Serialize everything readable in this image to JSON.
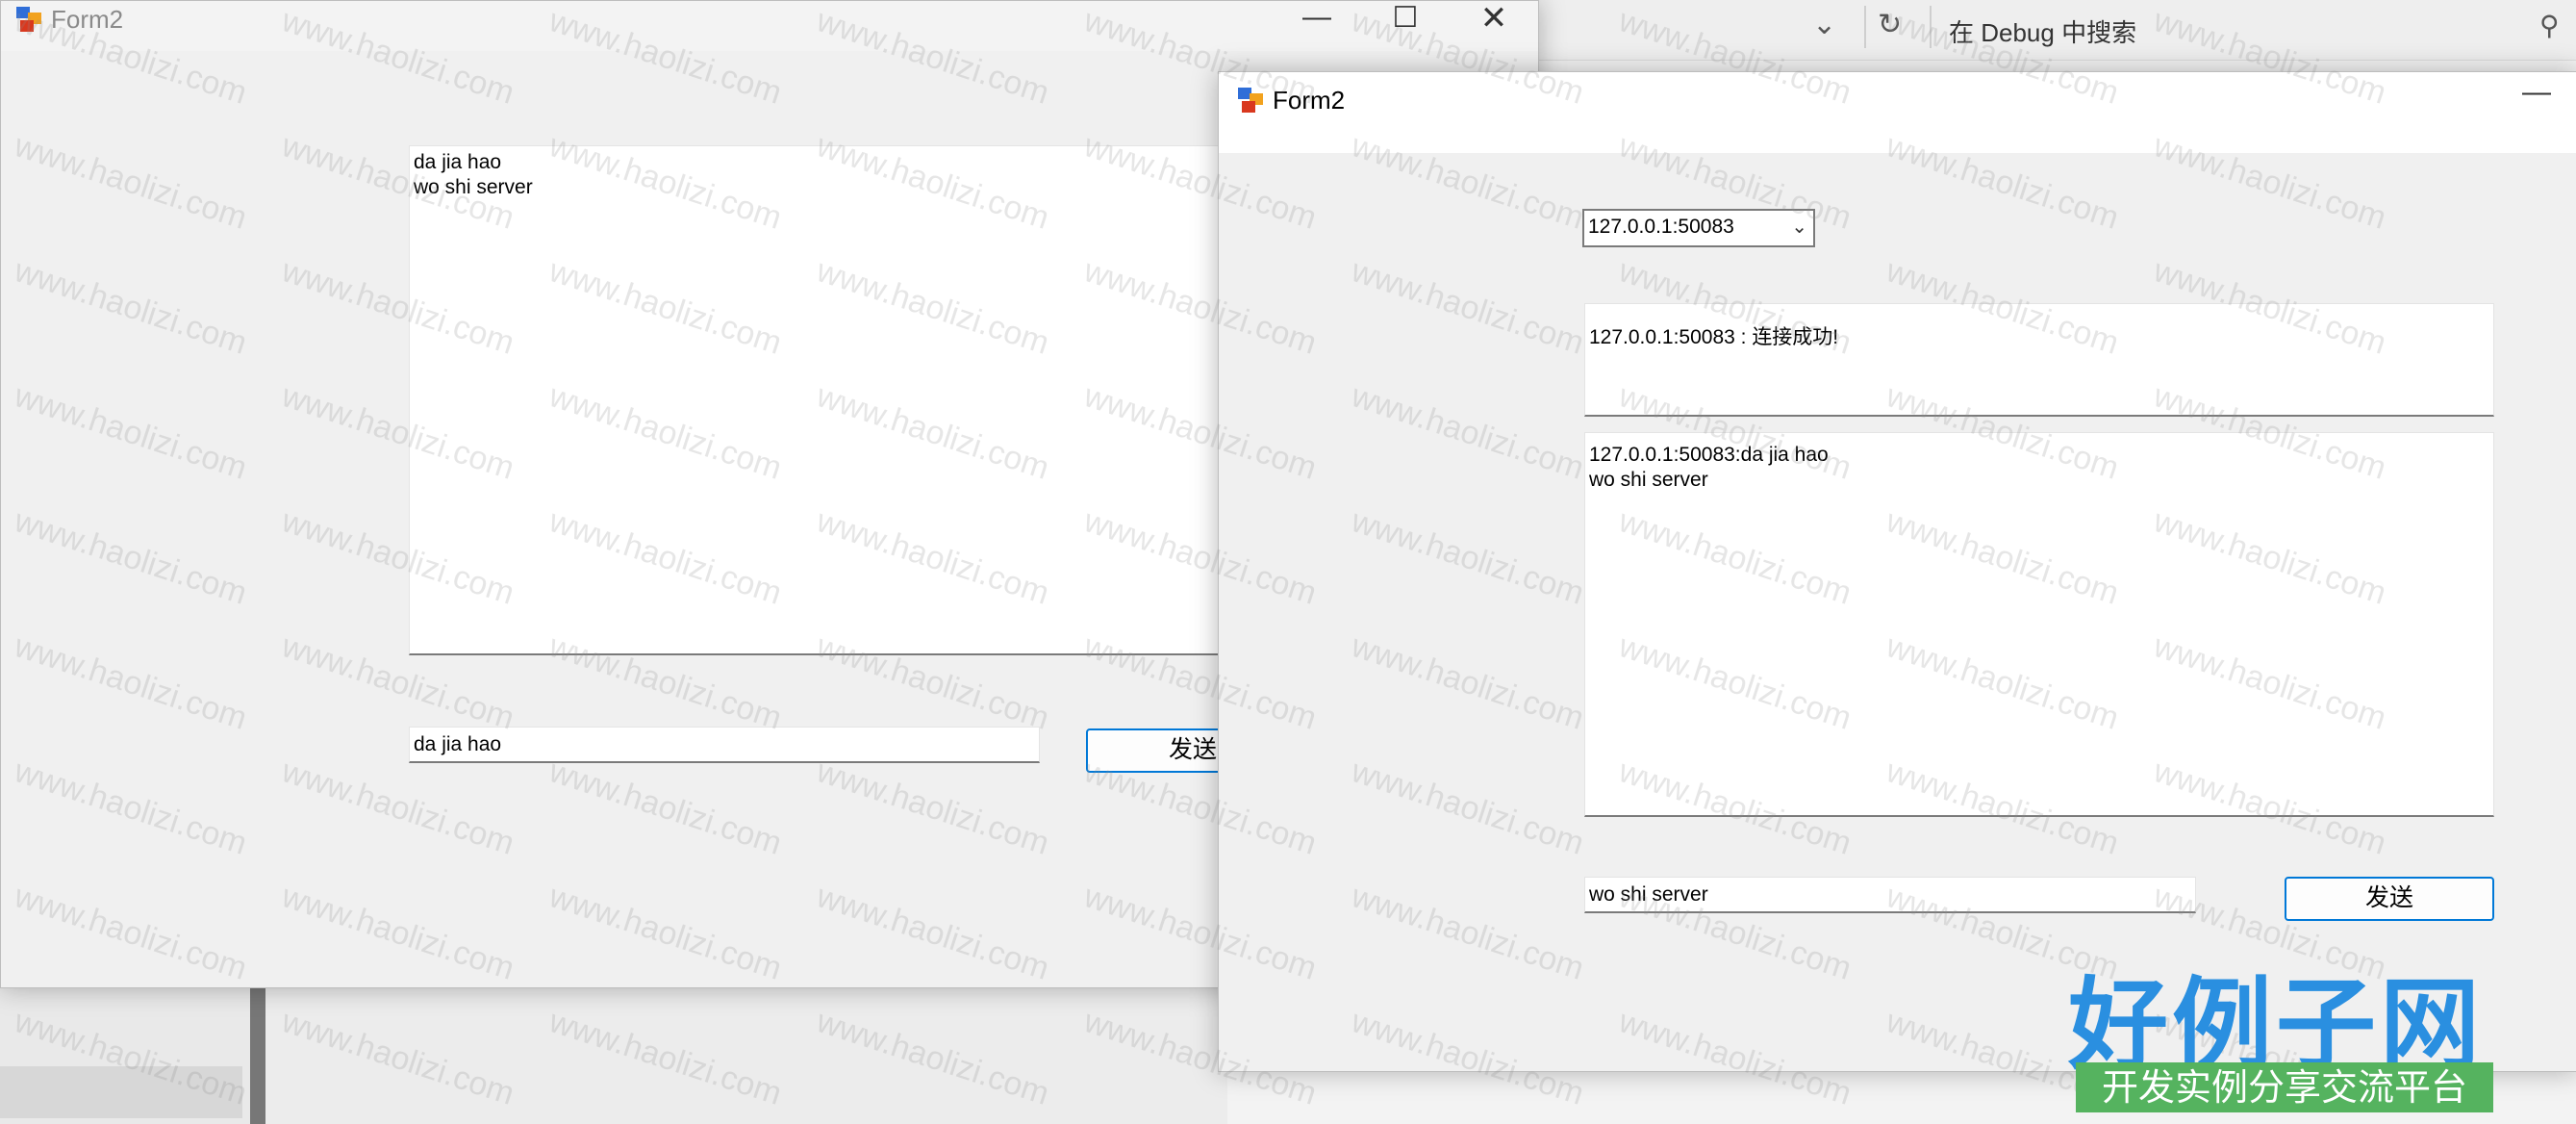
{
  "ide": {
    "search_placeholder": "在 Debug 中搜索",
    "icons": [
      "chevron-down-icon",
      "refresh-icon",
      "search-icon"
    ]
  },
  "back_window": {
    "title": "Form2",
    "received_text": "da jia hao\nwo shi server",
    "input_value": "da jia hao",
    "send_label": "发送"
  },
  "front_window": {
    "title": "Form2",
    "client_select": "127.0.0.1:50083",
    "status_text": "127.0.0.1:50083 : 连接成功!",
    "message_log": "127.0.0.1:50083:da jia hao\nwo shi server",
    "input_value": "wo shi server",
    "send_label": "发送"
  },
  "watermark": "www.haolizi.com",
  "logo": {
    "main": "好例子网",
    "sub": "开发实例分享交流平台"
  },
  "colors": {
    "accent": "#0078d7",
    "logo_blue": "#2a8fe0",
    "logo_green": "#55b35f"
  }
}
